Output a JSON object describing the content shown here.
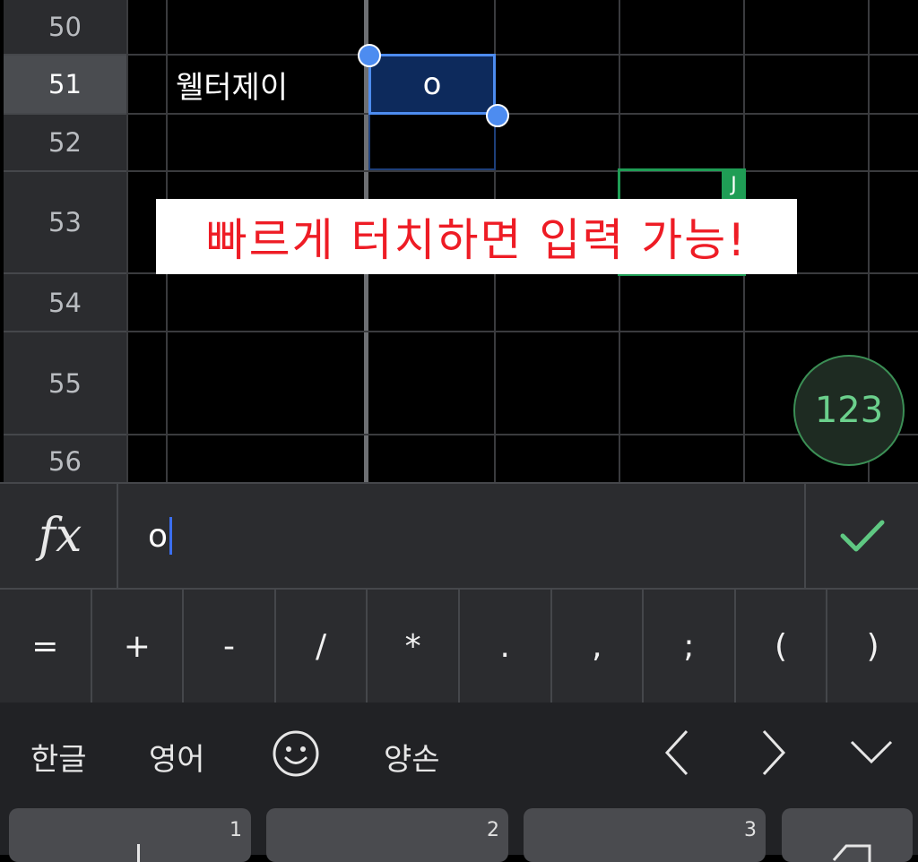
{
  "sheet": {
    "rows": [
      {
        "num": "50",
        "name_cell": "",
        "active": false
      },
      {
        "num": "51",
        "name_cell": "웰터제이",
        "active": true
      },
      {
        "num": "52",
        "name_cell": "",
        "active": false
      },
      {
        "num": "53",
        "name_cell": "",
        "active": false
      },
      {
        "num": "54",
        "name_cell": "",
        "active": false
      },
      {
        "num": "55",
        "name_cell": "",
        "active": false
      },
      {
        "num": "56",
        "name_cell": "",
        "active": false
      }
    ],
    "selected_cell_value": "o",
    "green_tag_label": "J",
    "overlay_text": "빠르게 터치하면 입력 가능!"
  },
  "numeric_keyboard_button": "123",
  "formula_bar": {
    "fx_label": "fx",
    "input_value": "o"
  },
  "operator_keys": [
    "=",
    "+",
    "-",
    "/",
    "*",
    ".",
    ",",
    ";",
    "(",
    ")"
  ],
  "keyboard_toolbar": {
    "korean": "한글",
    "english": "영어",
    "emoji_icon": "smiley-icon",
    "form": "양손"
  },
  "keyboard_keys": [
    {
      "number": "1"
    },
    {
      "number": "2"
    },
    {
      "number": "3"
    }
  ],
  "colors": {
    "selection": "#4d8cf0",
    "accent_green": "#1f9d55",
    "overlay_text": "#ee1c25"
  }
}
